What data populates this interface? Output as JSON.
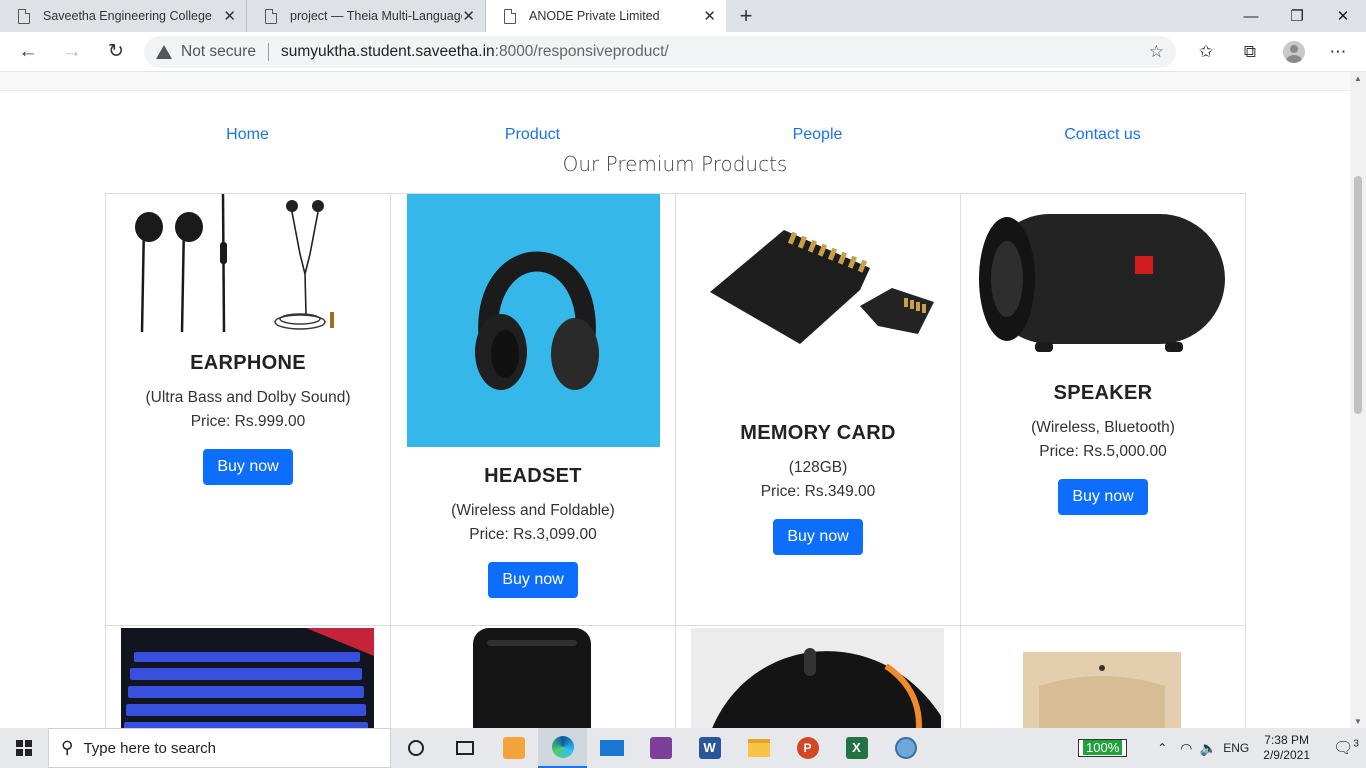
{
  "browser": {
    "tabs": [
      {
        "title": "Saveetha Engineering College",
        "active": false
      },
      {
        "title": "project — Theia Multi-Language",
        "active": false
      },
      {
        "title": "ANODE Private Limited",
        "active": true
      }
    ],
    "security_label": "Not secure",
    "url_host": "sumyuktha.student.saveetha.in",
    "url_path": ":8000/responsiveproduct/"
  },
  "nav": {
    "items": [
      "Home",
      "Product",
      "People",
      "Contact us"
    ]
  },
  "page": {
    "heading": "Our Premium Products"
  },
  "products": [
    {
      "name": "EARPHONE",
      "description": "(Ultra Bass and Dolby Sound)",
      "price": "Price: Rs.999.00",
      "button": "Buy now"
    },
    {
      "name": "HEADSET",
      "description": "(Wireless and Foldable)",
      "price": "Price: Rs.3,099.00",
      "button": "Buy now"
    },
    {
      "name": "MEMORY CARD",
      "description": "(128GB)",
      "price": "Price: Rs.349.00",
      "button": "Buy now"
    },
    {
      "name": "SPEAKER",
      "description": "(Wireless, Bluetooth)",
      "price": "Price: Rs.5,000.00",
      "button": "Buy now"
    }
  ],
  "second_row_images": [
    "keyboard-image",
    "router-image",
    "mouse-image",
    "wooden-stand-image"
  ],
  "taskbar": {
    "search_placeholder": "Type here to search",
    "battery": "100%",
    "language": "ENG",
    "time": "7:38 PM",
    "date": "2/9/2021",
    "notifications": "3"
  },
  "colors": {
    "link": "#1a73e8",
    "button": "#0d6efd",
    "headset_bg": "#35b8e9"
  }
}
